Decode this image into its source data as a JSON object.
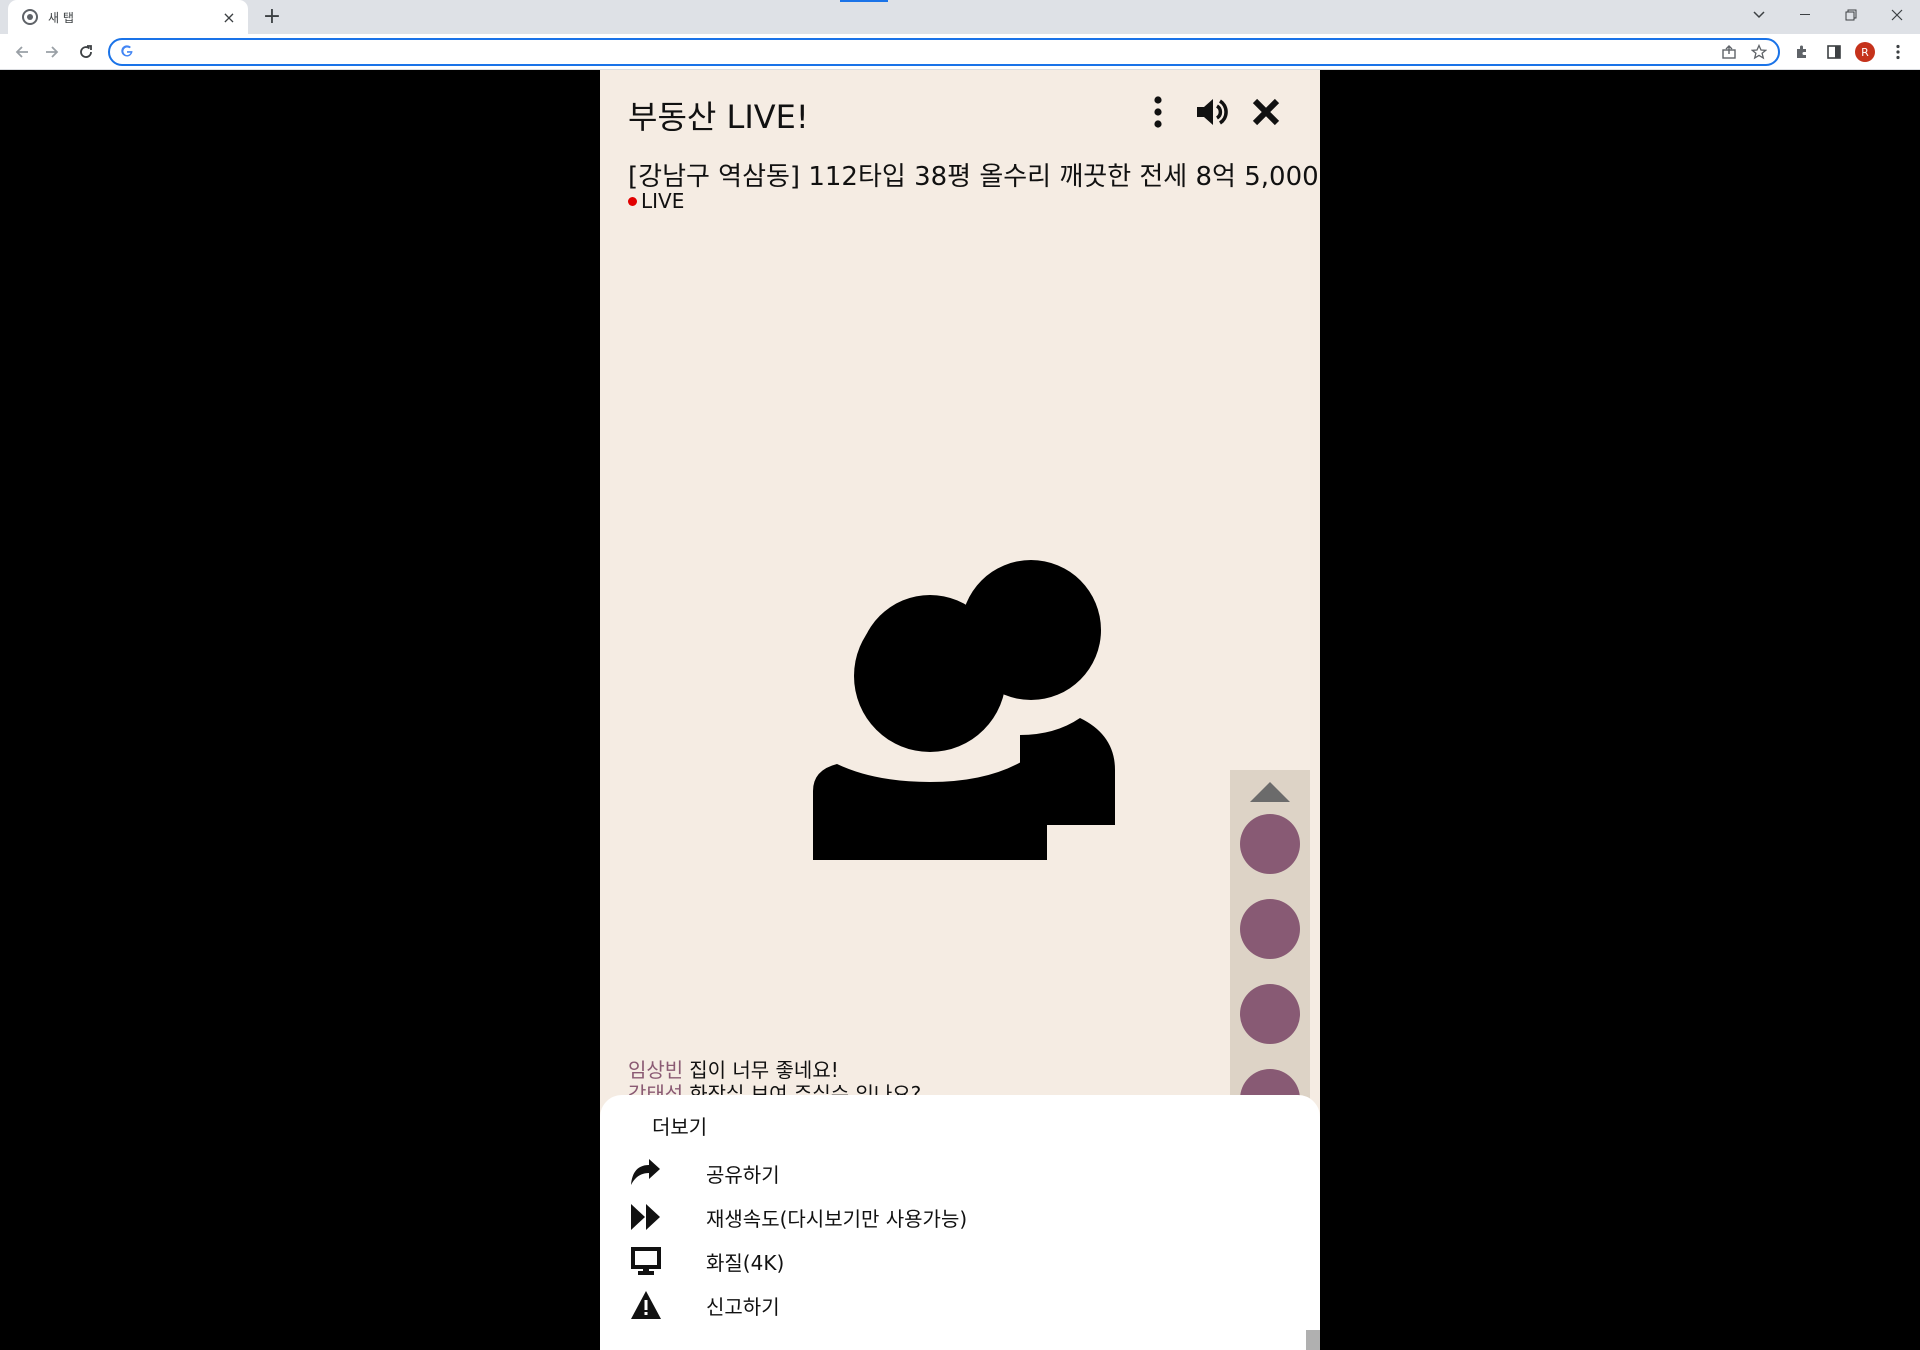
{
  "browser": {
    "tab_title": "새 탭",
    "tab_close": "×",
    "new_tab": "+",
    "avatar_initial": "R",
    "omnibox_value": "",
    "accent_color": "#1a73e8"
  },
  "app": {
    "title": "부동산 LIVE!",
    "listing_title": "[강남구 역삼동] 112타입 38평 올수리 깨끗한 전세 8억 5,000",
    "live_label": "LIVE",
    "colors": {
      "background": "#f5ece3",
      "live_dot": "#e10000",
      "avatar": "#885a74",
      "username": "#8a5a73",
      "rail": "#ddd3c6"
    }
  },
  "chat": [
    {
      "user": "임상빈",
      "message": "집이 너무 좋네요!"
    },
    {
      "user": "강태성",
      "message": "화장실 보여 주실수 있나요?"
    }
  ],
  "viewers": [
    {
      "icon": "viewer-avatar"
    },
    {
      "icon": "viewer-avatar"
    },
    {
      "icon": "viewer-avatar"
    },
    {
      "icon": "viewer-avatar"
    }
  ],
  "sheet": {
    "title": "더보기",
    "items": [
      {
        "icon": "share-icon",
        "label": "공유하기"
      },
      {
        "icon": "fast-forward-icon",
        "label": "재생속도(다시보기만 사용가능)"
      },
      {
        "icon": "monitor-icon",
        "label": "화질(4K)"
      },
      {
        "icon": "warning-icon",
        "label": "신고하기"
      }
    ]
  }
}
